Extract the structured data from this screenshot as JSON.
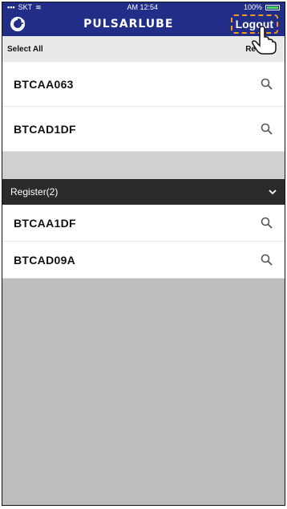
{
  "status_bar": {
    "carrier": "SKT",
    "time": "AM 12:54",
    "battery": "100%"
  },
  "header": {
    "logo": "PULSARLUBE",
    "logout_label": "Logout"
  },
  "toolbar": {
    "select_all": "Select All",
    "right_label": "Re"
  },
  "unregistered": [
    {
      "name": "BTCAA063"
    },
    {
      "name": "BTCAD1DF"
    }
  ],
  "registered_section": {
    "label": "Register(2)"
  },
  "registered": [
    {
      "name": "BTCAA1DF"
    },
    {
      "name": "BTCAD09A"
    }
  ],
  "colors": {
    "header": "#222d87",
    "section": "#2b2b2b",
    "highlight": "#f39a1f",
    "background": "#bdbdbd"
  }
}
